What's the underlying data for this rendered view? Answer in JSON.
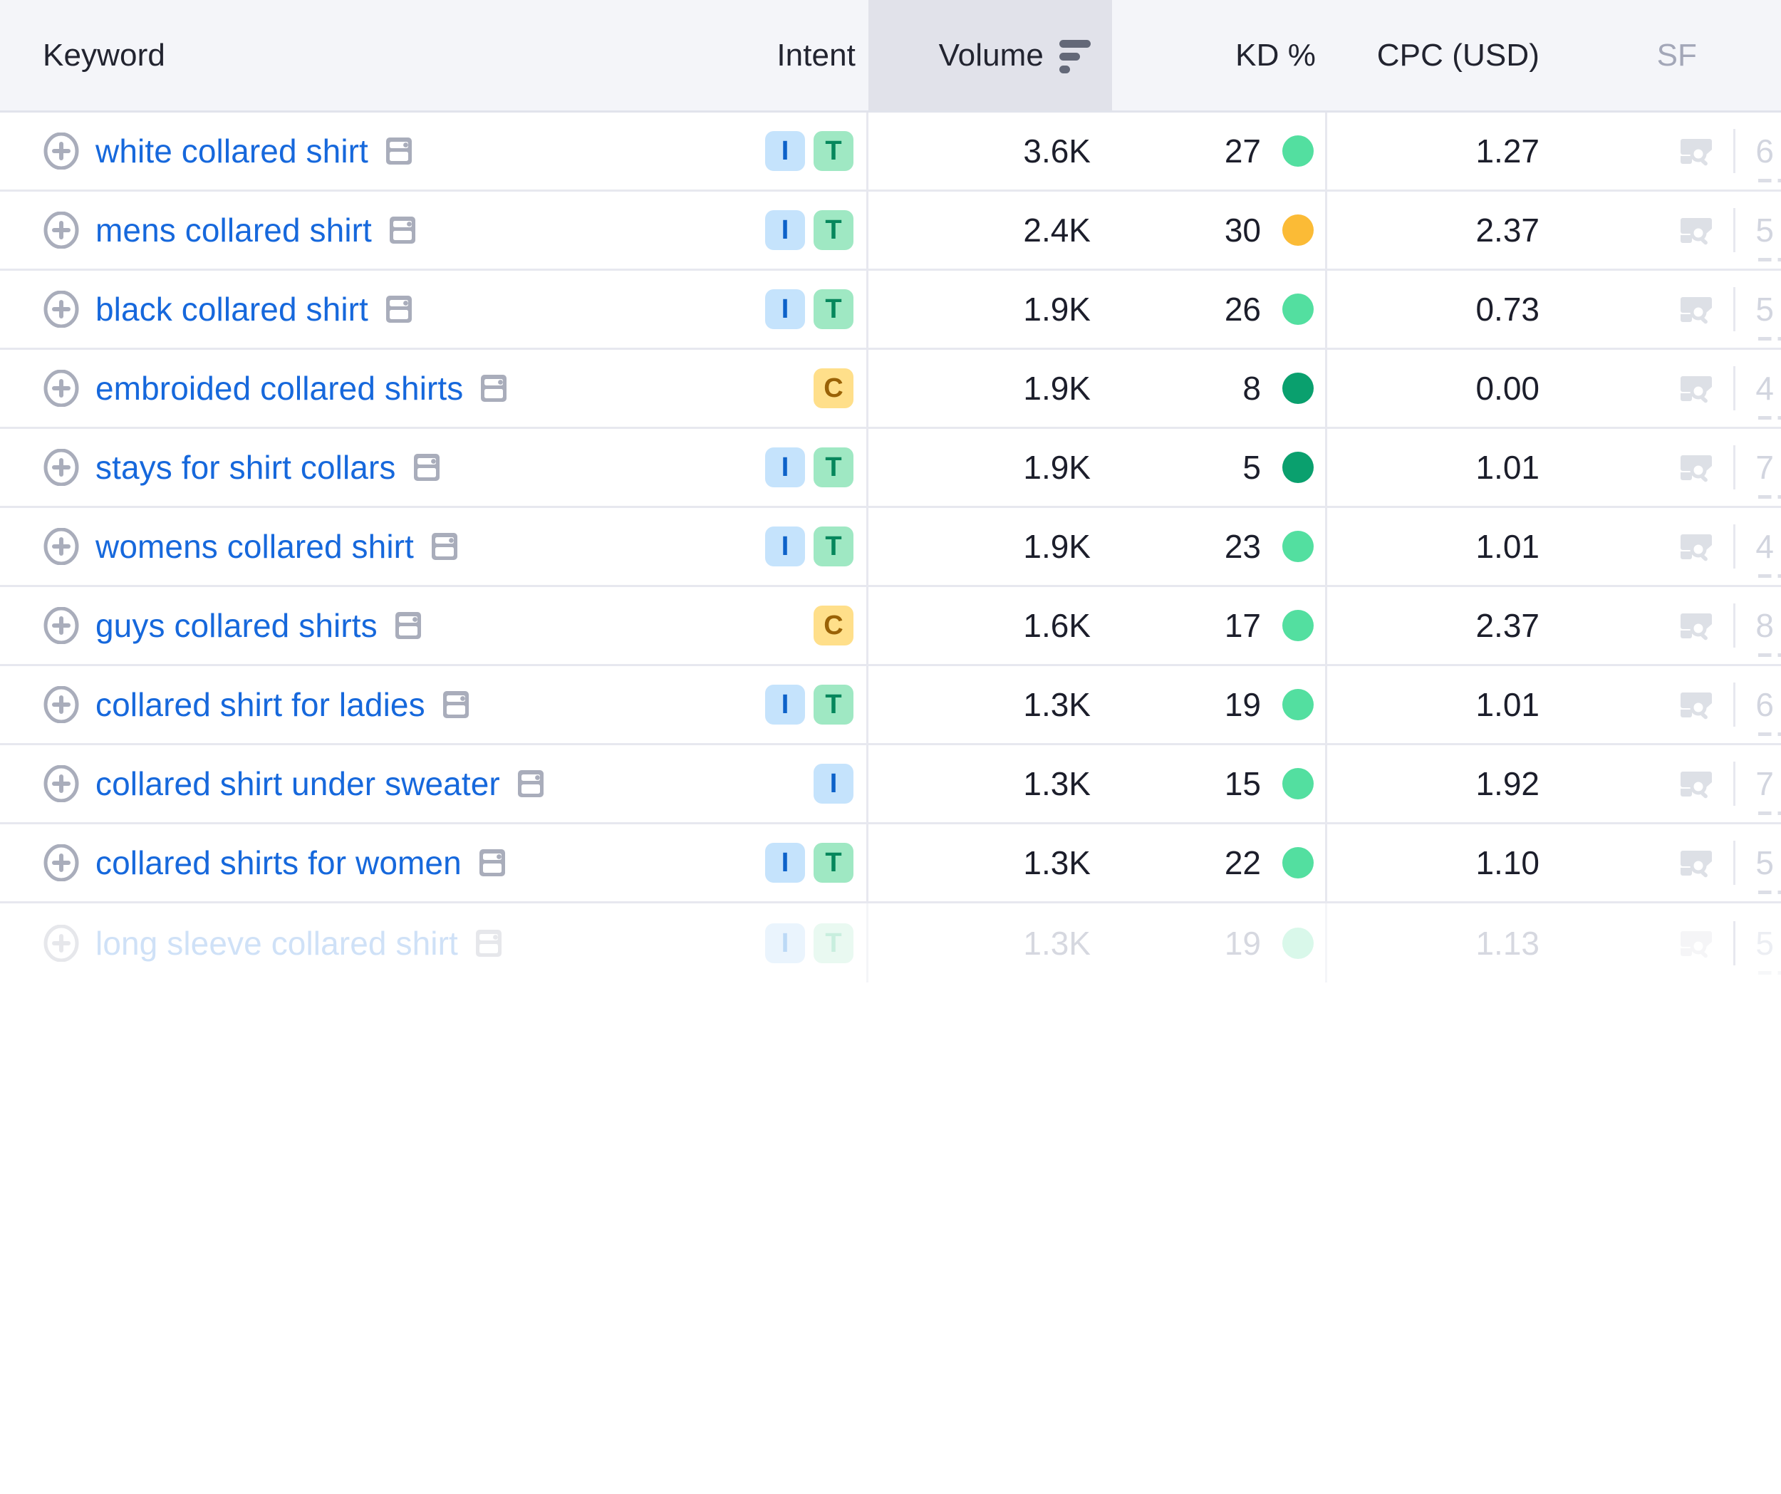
{
  "table": {
    "columns": [
      {
        "key": "keyword",
        "label": "Keyword",
        "sorted": false
      },
      {
        "key": "intent",
        "label": "Intent",
        "sorted": false
      },
      {
        "key": "volume",
        "label": "Volume",
        "sorted": true,
        "sort_icon": "sort-descending-icon"
      },
      {
        "key": "kd",
        "label": "KD %",
        "sorted": false
      },
      {
        "key": "cpc",
        "label": "CPC (USD)",
        "sorted": false
      },
      {
        "key": "sf",
        "label": "SF",
        "sorted": false
      }
    ],
    "colors": {
      "link": "#1668dc",
      "header_bg": "#f4f5f9",
      "sorted_col_bg": "#e1e2ea",
      "row_border": "#e7e8ef",
      "intent_informational_bg": "#c5e3fc",
      "intent_informational_fg": "#0d62c9",
      "intent_transactional_bg": "#9fe8c3",
      "intent_transactional_fg": "#06875c",
      "intent_commercial_bg": "#ffdf8a",
      "intent_commercial_fg": "#9a6206",
      "kd_easy": "#0aa06e",
      "kd_medium": "#53dfa0",
      "kd_hard": "#fbbb36"
    },
    "icons": {
      "add_keyword": "plus-circle-icon",
      "serp_preview": "serp-preview-icon",
      "serp_features": "serp-features-icon"
    },
    "rows": [
      {
        "keyword": "white collared shirt",
        "intent": [
          "I",
          "T"
        ],
        "volume": "3.6K",
        "kd": "27",
        "kd_level": "medium",
        "cpc": "1.27",
        "sf": "6",
        "faded": false
      },
      {
        "keyword": "mens collared shirt",
        "intent": [
          "I",
          "T"
        ],
        "volume": "2.4K",
        "kd": "30",
        "kd_level": "hard",
        "cpc": "2.37",
        "sf": "5",
        "faded": false
      },
      {
        "keyword": "black collared shirt",
        "intent": [
          "I",
          "T"
        ],
        "volume": "1.9K",
        "kd": "26",
        "kd_level": "medium",
        "cpc": "0.73",
        "sf": "5",
        "faded": false
      },
      {
        "keyword": "embroided collared shirts",
        "intent": [
          "C"
        ],
        "volume": "1.9K",
        "kd": "8",
        "kd_level": "easy",
        "cpc": "0.00",
        "sf": "4",
        "faded": false
      },
      {
        "keyword": "stays for shirt collars",
        "intent": [
          "I",
          "T"
        ],
        "volume": "1.9K",
        "kd": "5",
        "kd_level": "easy",
        "cpc": "1.01",
        "sf": "7",
        "faded": false
      },
      {
        "keyword": "womens collared shirt",
        "intent": [
          "I",
          "T"
        ],
        "volume": "1.9K",
        "kd": "23",
        "kd_level": "medium",
        "cpc": "1.01",
        "sf": "4",
        "faded": false
      },
      {
        "keyword": "guys collared shirts",
        "intent": [
          "C"
        ],
        "volume": "1.6K",
        "kd": "17",
        "kd_level": "medium",
        "cpc": "2.37",
        "sf": "8",
        "faded": false
      },
      {
        "keyword": "collared shirt for ladies",
        "intent": [
          "I",
          "T"
        ],
        "volume": "1.3K",
        "kd": "19",
        "kd_level": "medium",
        "cpc": "1.01",
        "sf": "6",
        "faded": false
      },
      {
        "keyword": "collared shirt under sweater",
        "intent": [
          "I"
        ],
        "volume": "1.3K",
        "kd": "15",
        "kd_level": "medium",
        "cpc": "1.92",
        "sf": "7",
        "faded": false
      },
      {
        "keyword": "collared shirts for women",
        "intent": [
          "I",
          "T"
        ],
        "volume": "1.3K",
        "kd": "22",
        "kd_level": "medium",
        "cpc": "1.10",
        "sf": "5",
        "faded": false
      },
      {
        "keyword": "long sleeve collared shirt",
        "intent": [
          "I",
          "T"
        ],
        "volume": "1.3K",
        "kd": "19",
        "kd_level": "medium",
        "cpc": "1.13",
        "sf": "5",
        "faded": true
      }
    ]
  }
}
